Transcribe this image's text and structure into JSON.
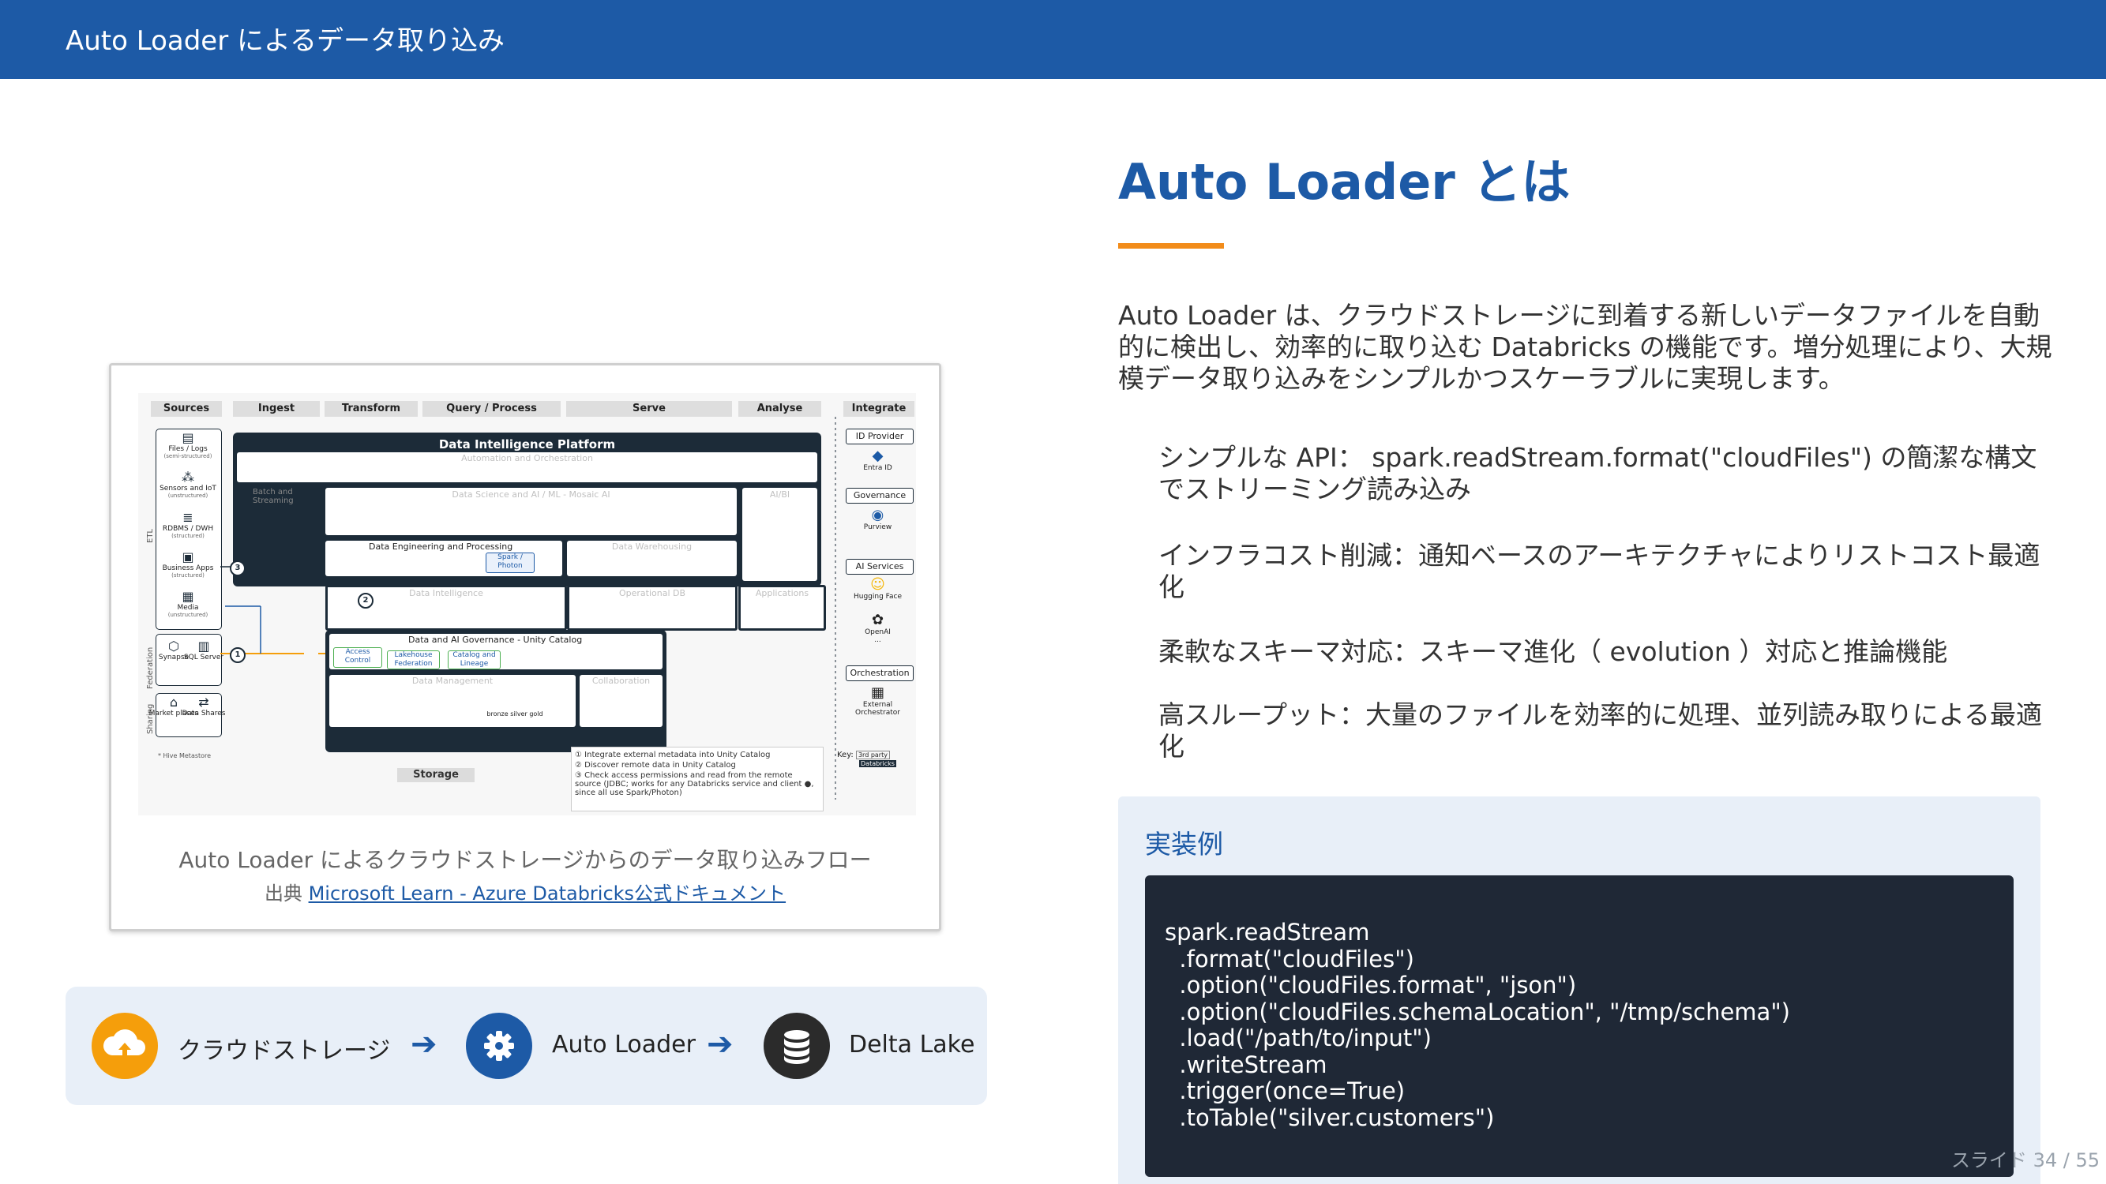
{
  "header": {
    "title": "Auto Loader によるデータ取り込み"
  },
  "figure": {
    "columns": [
      "Sources",
      "Ingest",
      "Transform",
      "Query / Process",
      "Serve",
      "Analyse",
      "Integrate"
    ],
    "sources": [
      {
        "label": "Files / Logs",
        "sub": "(semi-structured)"
      },
      {
        "label": "Sensors and IoT",
        "sub": "(unstructured)"
      },
      {
        "label": "RDBMS / DWH",
        "sub": "(structured)"
      },
      {
        "label": "Business Apps",
        "sub": "(structured)"
      },
      {
        "label": "Media",
        "sub": "(unstructured)"
      }
    ],
    "side_labels": {
      "etl": "ETL",
      "federation": "Federation",
      "sharing": "Sharing"
    },
    "federation_items": [
      "Synapse",
      "SQL Server"
    ],
    "sharing_items": [
      "Market places",
      "Data Shares"
    ],
    "platform_title": "Data Intelligence Platform",
    "cells": {
      "automation": "Automation and Orchestration",
      "batch": "Batch and Streaming",
      "ds_ml": "Data Science and AI / ML - Mosaic AI",
      "aibi": "AI/BI",
      "data_eng": "Data Engineering and Processing",
      "spark": "Spark / Photon",
      "warehousing": "Data Warehousing",
      "intelligence": "Data Intelligence",
      "operational": "Operational DB",
      "applications": "Applications",
      "governance": "Data and AI Governance - Unity Catalog",
      "access": "Access Control",
      "lakehouse_fed": "Lakehouse Federation",
      "catalog": "Catalog and Lineage",
      "data_mgmt": "Data Management",
      "collaboration": "Collaboration",
      "medallion": "bronze  silver  gold"
    },
    "integrate": {
      "id_provider": "ID Provider",
      "entra": "Entra ID",
      "governance": "Governance",
      "purview": "Purview",
      "ai_services": "AI Services",
      "hugging": "Hugging Face",
      "openai": "OpenAI",
      "dots": "...",
      "orchestration": "Orchestration",
      "external": "External Orchestrator"
    },
    "hive_note": "* Hive Metastore",
    "storage": "Storage",
    "legend": [
      "Integrate external metadata into Unity Catalog",
      "Discover remote data in Unity Catalog",
      "Check access permissions and read from the remote source (JDBC; works for any Databricks service and client ●, since all use Spark/Photon)"
    ],
    "key_label": "Key:",
    "key_items": [
      "3rd party",
      "Databricks"
    ],
    "caption": "Auto Loader によるクラウドストレージからのデータ取り込みフロー",
    "source_prefix": "出典",
    "source_link": "Microsoft Learn - Azure Databricks公式ドキュメント"
  },
  "flow": {
    "steps": [
      {
        "label": "クラウドストレージ",
        "icon": "cloud-upload-icon",
        "color": "#f59e0b"
      },
      {
        "label": "Auto Loader",
        "icon": "gear-icon",
        "color": "#1d5aa6"
      },
      {
        "label": "Delta Lake",
        "icon": "database-icon",
        "color": "#2b2b2b"
      }
    ],
    "arrow": "➔"
  },
  "main": {
    "title": "Auto Loader とは",
    "intro": "Auto Loader は、クラウドストレージに到着する新しいデータファイルを自動的に検出し、効率的に取り込む Databricks の機能です。増分処理により、大規模データ取り込みをシンプルかつスケーラブルに実現します。",
    "features": [
      "シンプルな API： spark.readStream.format(\"cloudFiles\") の簡潔な構文でストリーミング読み込み",
      "インフラコスト削減：通知ベースのアーキテクチャによりリストコスト最適化",
      "柔軟なスキーマ対応：スキーマ進化（ evolution ）対応と推論機能",
      "高スループット：大量のファイルを効率的に処理、並列読み取りによる最適化"
    ],
    "example_title": "実装例",
    "code": "spark.readStream\n  .format(\"cloudFiles\")\n  .option(\"cloudFiles.format\", \"json\")\n  .option(\"cloudFiles.schemaLocation\", \"/tmp/schema\")\n  .load(\"/path/to/input\")\n  .writeStream\n  .trigger(once=True)\n  .toTable(\"silver.customers\")"
  },
  "footer": {
    "slide_number": "スライド 34 / 55"
  },
  "colors": {
    "brand": "#1d5aa6",
    "accent": "#f28c1a",
    "code_bg": "#1f2836"
  }
}
